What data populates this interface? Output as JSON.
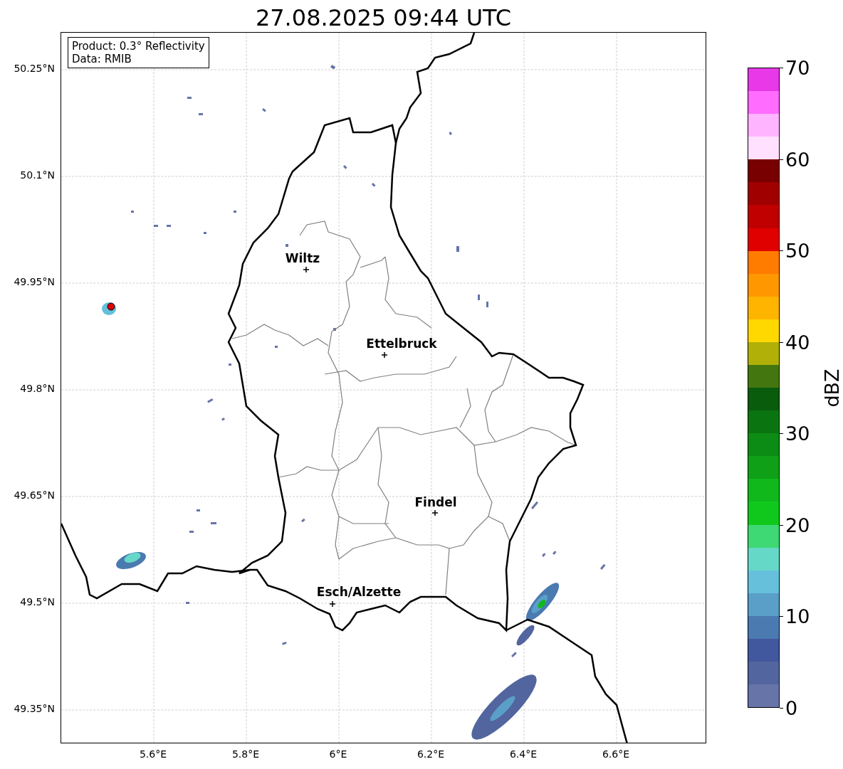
{
  "title": "27.08.2025 09:44 UTC",
  "info_box": {
    "lines": [
      "Product: 0.3° Reflectivity",
      "Data: RMIB"
    ]
  },
  "yticks": [
    "50.25°N",
    "50.1°N",
    "49.95°N",
    "49.8°N",
    "49.65°N",
    "49.5°N",
    "49.35°N"
  ],
  "xticks": [
    "5.6°E",
    "5.8°E",
    "6°E",
    "6.2°E",
    "6.4°E",
    "6.6°E"
  ],
  "cities": [
    {
      "name": "Wiltz"
    },
    {
      "name": "Ettelbruck"
    },
    {
      "name": "Findel"
    },
    {
      "name": "Esch/Alzette"
    }
  ],
  "colorbar": {
    "label": "dBZ",
    "ticks": [
      "70",
      "60",
      "50",
      "40",
      "30",
      "20",
      "10",
      "0"
    ],
    "bands": [
      {
        "color": "#e838e8"
      },
      {
        "color": "#ff6cff"
      },
      {
        "color": "#ffb4ff"
      },
      {
        "color": "#ffe0ff"
      },
      {
        "color": "#780000"
      },
      {
        "color": "#a00000"
      },
      {
        "color": "#c00000"
      },
      {
        "color": "#e00000"
      },
      {
        "color": "#ff7c00"
      },
      {
        "color": "#ff9800"
      },
      {
        "color": "#ffb400"
      },
      {
        "color": "#ffd800"
      },
      {
        "color": "#b0b008"
      },
      {
        "color": "#447610"
      },
      {
        "color": "#085c0c"
      },
      {
        "color": "#0a7410"
      },
      {
        "color": "#0c8c14"
      },
      {
        "color": "#10a018"
      },
      {
        "color": "#10b81c"
      },
      {
        "color": "#10c81c"
      },
      {
        "color": "#3ed874"
      },
      {
        "color": "#66d8c8"
      },
      {
        "color": "#66c0dc"
      },
      {
        "color": "#5a9fc8"
      },
      {
        "color": "#4a7ab0"
      },
      {
        "color": "#42589e"
      },
      {
        "color": "#52659e"
      },
      {
        "color": "#6674a8"
      }
    ]
  }
}
